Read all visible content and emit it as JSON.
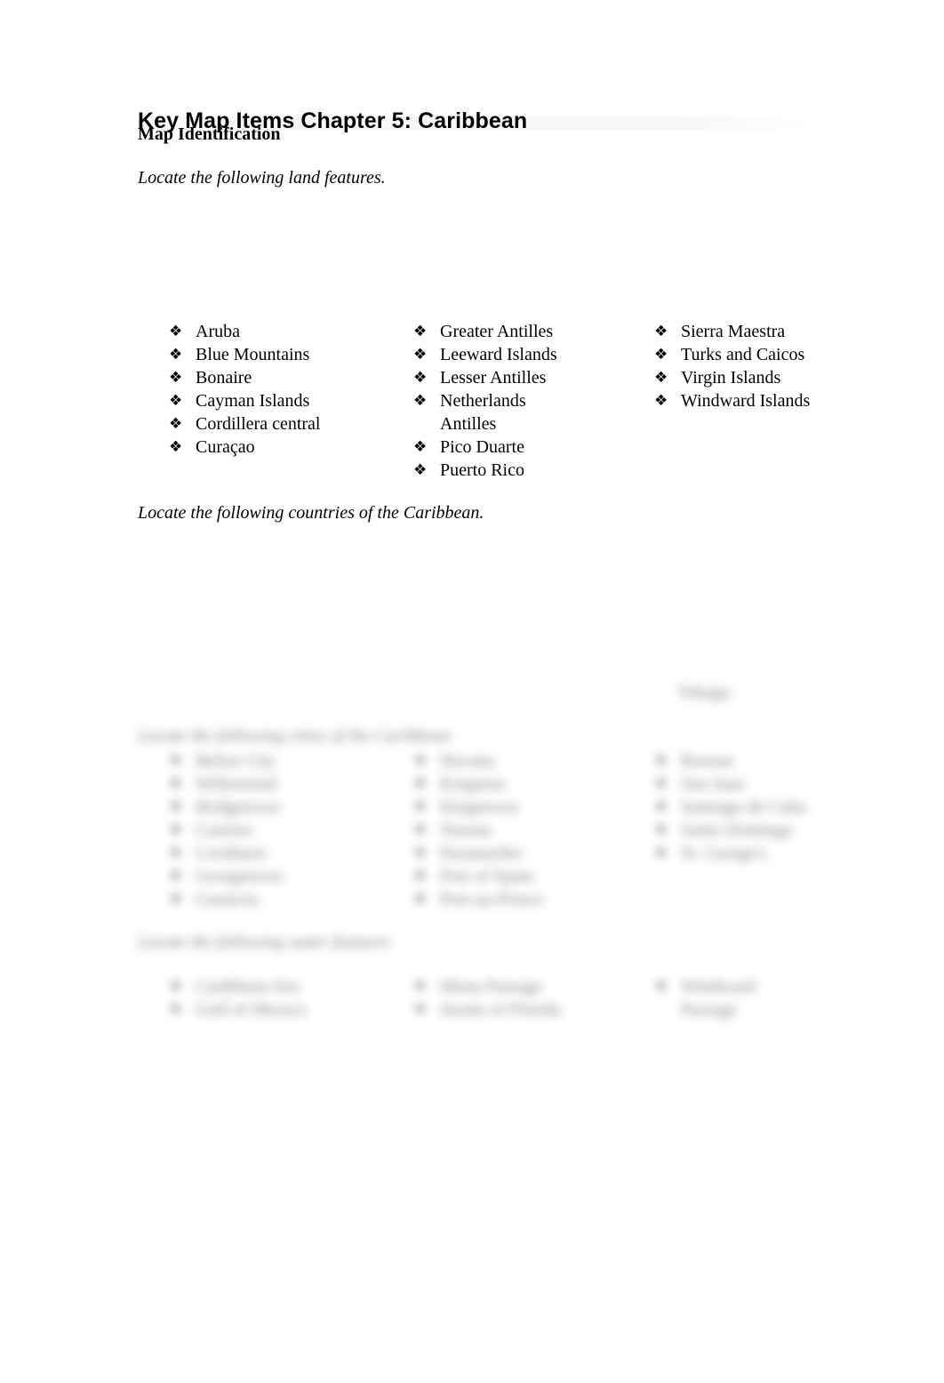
{
  "document": {
    "title": "Key Map Items Chapter 5: Caribbean",
    "section_label": "Map Identification",
    "background_color": "#ffffff",
    "text_color": "#000000",
    "header_band_color": "#f7f7f7"
  },
  "bullet_glyph": "❖",
  "sections": {
    "land_features": {
      "instruction": "Locate the following land features.",
      "columns": [
        {
          "items": [
            "Aruba",
            "Blue Mountains",
            "Bonaire",
            "Cayman Islands",
            "Cordillera central",
            "Curaçao"
          ]
        },
        {
          "items": [
            "Greater Antilles",
            "Leeward Islands",
            "Lesser Antilles",
            "Netherlands Antilles",
            "Pico Duarte",
            "Puerto Rico"
          ]
        },
        {
          "items": [
            "Sierra Maestra",
            "Turks and Caicos",
            "Virgin Islands",
            "Windward Islands"
          ]
        }
      ]
    },
    "countries": {
      "instruction": "Locate the following countries of the Caribbean.",
      "blurred": true,
      "visible_tail": {
        "column_1": "",
        "column_2": "",
        "column_3": "Tobago"
      }
    },
    "cities": {
      "instruction_blurred": "Locate the following cities of the Caribbean",
      "blurred": true,
      "columns": [
        {
          "items": [
            "Belize City",
            "Willemstad",
            "Bridgetown",
            "Castries",
            "Cockburn",
            "Georgetown",
            "Gustavia"
          ]
        },
        {
          "items": [
            "Havana",
            "Kingston",
            "Kingstown",
            "Nassau",
            "Paramaribo",
            "Port of Spain",
            "Port-au-Prince"
          ]
        },
        {
          "items": [
            "Roseau",
            "San Juan",
            "Santiago de Cuba",
            "Santo Domingo",
            "St. George's"
          ]
        }
      ]
    },
    "waterways": {
      "instruction_blurred": "Locate the following water features",
      "blurred": true,
      "columns": [
        {
          "items": [
            "Caribbean Sea",
            "Gulf of Mexico"
          ]
        },
        {
          "items": [
            "Mona Passage",
            "Straits of Florida"
          ]
        },
        {
          "items": [
            "Windward Passage"
          ]
        }
      ]
    }
  }
}
